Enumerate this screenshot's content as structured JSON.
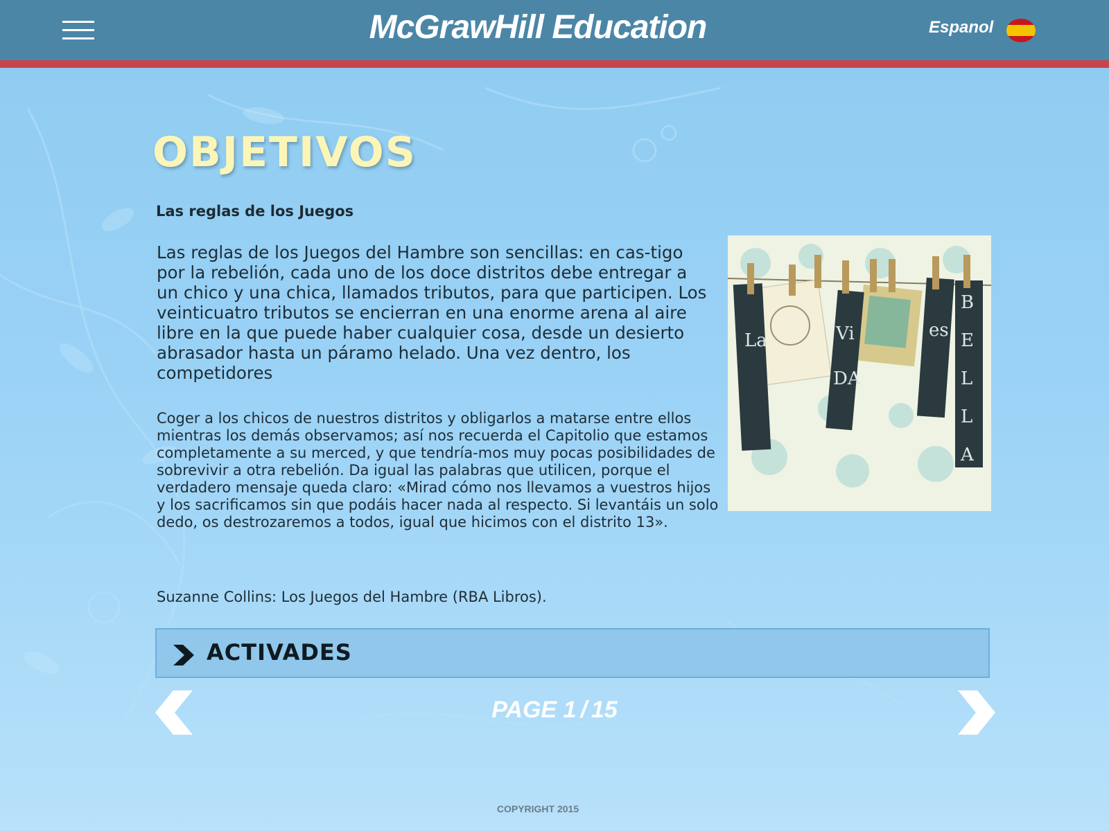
{
  "header": {
    "brand": "McGrawHill Education",
    "language_label": "Espanol",
    "menu_icon": "hamburger-icon",
    "flag_icon": "spain-flag-icon"
  },
  "main": {
    "title": "OBJETIVOS",
    "subtitle": "Las reglas de los Juegos",
    "paragraph1": "Las reglas de los Juegos del Hambre son sencillas: en cas-tigo por la rebelión, cada uno de los doce distritos debe entregar a un chico y una chica, llamados tributos, para que participen. Los veinticuatro tributos se encierran en una enorme arena al aire libre en la que puede haber cualquier cosa, desde un desierto abrasador hasta un páramo helado. Una vez dentro, los competidores",
    "paragraph2": "Coger a los chicos de nuestros distritos y obligarlos a matarse entre ellos mientras los demás observamos; así nos recuerda el Capitolio que estamos completamente a su merced, y que tendría-mos muy pocas posibilidades de sobrevivir a otra rebelión. Da igual las palabras que utilicen, porque el verdadero mensaje queda claro: «Mirad cómo nos llevamos a vuestros hijos y los sacrificamos sin que podáis hacer nada al respecto. Si levantáis un solo dedo, os destrozaremos a todos, igual que hicimos con el distrito 13».",
    "citation": "Suzanne Collins: Los Juegos del Hambre (RBA Libros).",
    "illustration_letters": [
      "La",
      "Vi",
      "DA",
      "es",
      "B",
      "E",
      "L",
      "L",
      "A"
    ]
  },
  "activities": {
    "label": "ACTIVADES",
    "icon": "chevron-right-icon"
  },
  "pagination": {
    "prefix": "PAGE",
    "current": "1",
    "separator": "/",
    "total": "15",
    "prev_icon": "arrow-left-icon",
    "next_icon": "arrow-right-icon"
  },
  "footer": {
    "copyright": "COPYRIGHT 2015"
  },
  "colors": {
    "header_bg": "#4b86a7",
    "header_stripe": "#c8444a",
    "title": "#fbf6b8",
    "activities_bg": "#90c7eb"
  }
}
